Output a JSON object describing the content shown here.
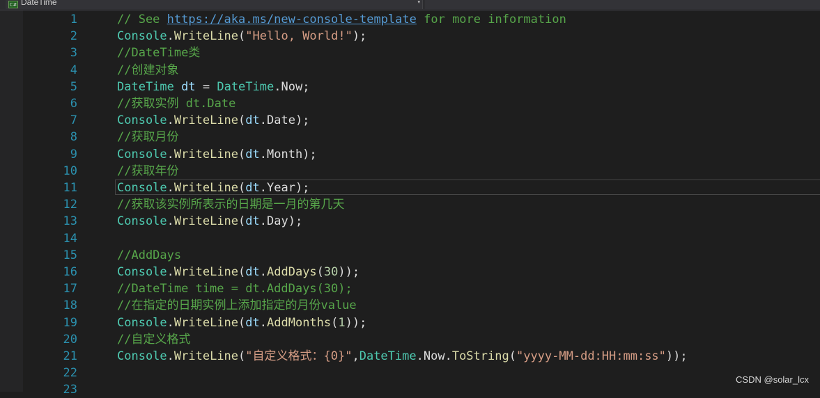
{
  "editor": {
    "member_combo": "DateTime",
    "combo_icon": "C#",
    "combo_arrow": "▾"
  },
  "lines": [
    {
      "n": "1",
      "tokens": [
        {
          "c": "c",
          "t": "// See "
        },
        {
          "c": "u",
          "t": "https://aka.ms/new-console-template"
        },
        {
          "c": "c",
          "t": " for more information"
        }
      ]
    },
    {
      "n": "2",
      "tokens": [
        {
          "c": "t",
          "t": "Console"
        },
        {
          "c": "p",
          "t": "."
        },
        {
          "c": "m",
          "t": "WriteLine"
        },
        {
          "c": "p",
          "t": "("
        },
        {
          "c": "s",
          "t": "\"Hello, World!\""
        },
        {
          "c": "p",
          "t": ");"
        }
      ]
    },
    {
      "n": "3",
      "tokens": [
        {
          "c": "c",
          "t": "//DateTime类"
        }
      ]
    },
    {
      "n": "4",
      "tokens": [
        {
          "c": "c",
          "t": "//创建对象"
        }
      ]
    },
    {
      "n": "5",
      "tokens": [
        {
          "c": "t",
          "t": "DateTime"
        },
        {
          "c": "p",
          "t": " "
        },
        {
          "c": "v",
          "t": "dt"
        },
        {
          "c": "p",
          "t": " = "
        },
        {
          "c": "t",
          "t": "DateTime"
        },
        {
          "c": "p",
          "t": "."
        },
        {
          "c": "p",
          "t": "Now"
        },
        {
          "c": "p",
          "t": ";"
        }
      ]
    },
    {
      "n": "6",
      "tokens": [
        {
          "c": "c",
          "t": "//获取实例 dt.Date"
        }
      ]
    },
    {
      "n": "7",
      "tokens": [
        {
          "c": "t",
          "t": "Console"
        },
        {
          "c": "p",
          "t": "."
        },
        {
          "c": "m",
          "t": "WriteLine"
        },
        {
          "c": "p",
          "t": "("
        },
        {
          "c": "v",
          "t": "dt"
        },
        {
          "c": "p",
          "t": ".Date);"
        }
      ]
    },
    {
      "n": "8",
      "tokens": [
        {
          "c": "c",
          "t": "//获取月份"
        }
      ]
    },
    {
      "n": "9",
      "tokens": [
        {
          "c": "t",
          "t": "Console"
        },
        {
          "c": "p",
          "t": "."
        },
        {
          "c": "m",
          "t": "WriteLine"
        },
        {
          "c": "p",
          "t": "("
        },
        {
          "c": "v",
          "t": "dt"
        },
        {
          "c": "p",
          "t": ".Month);"
        }
      ]
    },
    {
      "n": "10",
      "tokens": [
        {
          "c": "c",
          "t": "//获取年份"
        }
      ]
    },
    {
      "n": "11",
      "current": true,
      "tokens": [
        {
          "c": "t",
          "t": "Console"
        },
        {
          "c": "p",
          "t": "."
        },
        {
          "c": "m",
          "t": "WriteLine"
        },
        {
          "c": "p",
          "t": "("
        },
        {
          "c": "v",
          "t": "dt"
        },
        {
          "c": "p",
          "t": ".Year);"
        }
      ]
    },
    {
      "n": "12",
      "tokens": [
        {
          "c": "c",
          "t": "//获取该实例所表示的日期是一月的第几天"
        }
      ]
    },
    {
      "n": "13",
      "tokens": [
        {
          "c": "t",
          "t": "Console"
        },
        {
          "c": "p",
          "t": "."
        },
        {
          "c": "m",
          "t": "WriteLine"
        },
        {
          "c": "p",
          "t": "("
        },
        {
          "c": "v",
          "t": "dt"
        },
        {
          "c": "p",
          "t": ".Day);"
        }
      ]
    },
    {
      "n": "14",
      "tokens": []
    },
    {
      "n": "15",
      "tokens": [
        {
          "c": "c",
          "t": "//AddDays"
        }
      ]
    },
    {
      "n": "16",
      "tokens": [
        {
          "c": "t",
          "t": "Console"
        },
        {
          "c": "p",
          "t": "."
        },
        {
          "c": "m",
          "t": "WriteLine"
        },
        {
          "c": "p",
          "t": "("
        },
        {
          "c": "v",
          "t": "dt"
        },
        {
          "c": "p",
          "t": "."
        },
        {
          "c": "m",
          "t": "AddDays"
        },
        {
          "c": "p",
          "t": "("
        },
        {
          "c": "n",
          "t": "30"
        },
        {
          "c": "p",
          "t": "));"
        }
      ]
    },
    {
      "n": "17",
      "tokens": [
        {
          "c": "c",
          "t": "//DateTime time = dt.AddDays(30);"
        }
      ]
    },
    {
      "n": "18",
      "tokens": [
        {
          "c": "c",
          "t": "//在指定的日期实例上添加指定的月份value"
        }
      ]
    },
    {
      "n": "19",
      "tokens": [
        {
          "c": "t",
          "t": "Console"
        },
        {
          "c": "p",
          "t": "."
        },
        {
          "c": "m",
          "t": "WriteLine"
        },
        {
          "c": "p",
          "t": "("
        },
        {
          "c": "v",
          "t": "dt"
        },
        {
          "c": "p",
          "t": "."
        },
        {
          "c": "m",
          "t": "AddMonths"
        },
        {
          "c": "p",
          "t": "("
        },
        {
          "c": "n",
          "t": "1"
        },
        {
          "c": "p",
          "t": "));"
        }
      ]
    },
    {
      "n": "20",
      "tokens": [
        {
          "c": "c",
          "t": "//自定义格式"
        }
      ]
    },
    {
      "n": "21",
      "tokens": [
        {
          "c": "t",
          "t": "Console"
        },
        {
          "c": "p",
          "t": "."
        },
        {
          "c": "m",
          "t": "WriteLine"
        },
        {
          "c": "p",
          "t": "("
        },
        {
          "c": "s",
          "t": "\"自定义格式：{0}\""
        },
        {
          "c": "p",
          "t": ","
        },
        {
          "c": "t",
          "t": "DateTime"
        },
        {
          "c": "p",
          "t": "."
        },
        {
          "c": "p",
          "t": "Now"
        },
        {
          "c": "p",
          "t": "."
        },
        {
          "c": "m",
          "t": "ToString"
        },
        {
          "c": "p",
          "t": "("
        },
        {
          "c": "s",
          "t": "\"yyyy-MM-dd:HH:mm:ss\""
        },
        {
          "c": "p",
          "t": "));"
        }
      ]
    },
    {
      "n": "22",
      "tokens": []
    },
    {
      "n": "23",
      "tokens": []
    }
  ],
  "watermark": "CSDN @solar_lcx"
}
